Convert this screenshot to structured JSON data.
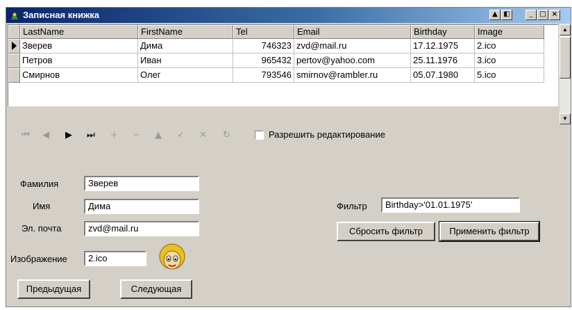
{
  "window": {
    "title": "Записная книжка"
  },
  "titlebar_buttons": {
    "restore": "▲",
    "pin": "◧",
    "minimize": "_",
    "maximize": "□",
    "close": "×"
  },
  "table": {
    "columns": [
      "LastName",
      "FirstName",
      "Tel",
      "Email",
      "Birthday",
      "Image"
    ],
    "rows": [
      [
        "Зверев",
        "Дима",
        "746323",
        "zvd@mail.ru",
        "17.12.1975",
        "2.ico"
      ],
      [
        "Петров",
        "Иван",
        "965432",
        "pertov@yahoo.com",
        "25.11.1976",
        "3.ico"
      ],
      [
        "Смирнов",
        "Олег",
        "793546",
        "smirnov@rambler.ru",
        "05.07.1980",
        "5.ico"
      ]
    ],
    "current_row": 0
  },
  "navigator": {
    "first": "⏮",
    "prior": "◀",
    "next": "▶",
    "last": "⏭",
    "insert": "+",
    "delete": "−",
    "edit": "▲",
    "post": "✓",
    "cancel": "✕",
    "refresh": "↻"
  },
  "edit_checkbox": {
    "label": "Разрешить редактирование",
    "checked": false
  },
  "form": {
    "lastname_label": "Фамилия",
    "lastname_value": "Зверев",
    "firstname_label": "Имя",
    "firstname_value": "Дима",
    "email_label": "Эл. почта",
    "email_value": "zvd@mail.ru",
    "image_label": "Изображение",
    "image_value": "2.ico"
  },
  "filter": {
    "label": "Фильтр",
    "value": "Birthday>'01.01.1975'",
    "reset_label": "Сбросить фильтр",
    "apply_label": "Применить фильтр"
  },
  "buttons": {
    "prev_label": "Предыдущая",
    "next_label": "Следующая"
  },
  "colors": {
    "titlebar": "#0a246a",
    "face": "#d4d0c8"
  }
}
